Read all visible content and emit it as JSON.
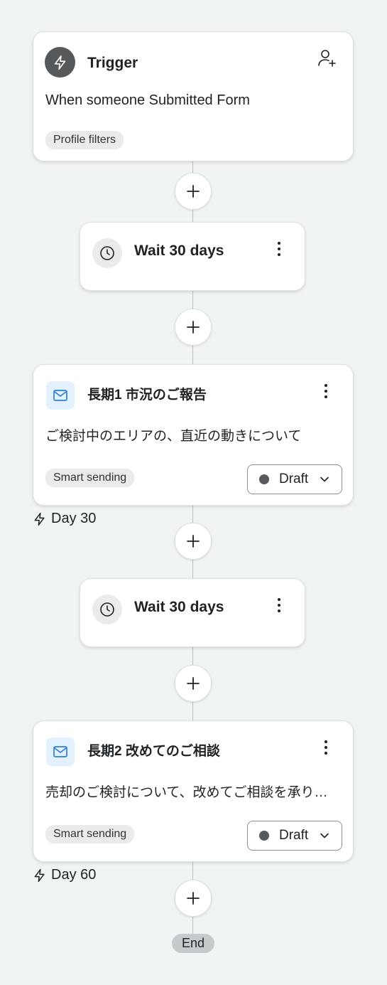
{
  "trigger": {
    "title": "Trigger",
    "description": "When someone Submitted Form",
    "filter_label": "Profile filters",
    "icon": "lightning-icon",
    "action_icon": "add-person-icon"
  },
  "wait_1": {
    "label": "Wait 30 days",
    "icon": "clock-icon"
  },
  "email_1": {
    "title": "長期1 市況のご報告",
    "preview": "ご検討中のエリアの、直近の動きについて",
    "smart_sending": "Smart sending",
    "status": "Draft",
    "day": "Day 30",
    "icon": "mail-icon"
  },
  "wait_2": {
    "label": "Wait 30 days",
    "icon": "clock-icon"
  },
  "email_2": {
    "title": "長期2 改めてのご相談",
    "preview": "売却のご検討について、改めてご相談を承り…",
    "smart_sending": "Smart sending",
    "status": "Draft",
    "day": "Day 60",
    "icon": "mail-icon"
  },
  "end_label": "End",
  "colors": {
    "background": "#f1f4f5",
    "card": "#ffffff",
    "trigger_icon_bg": "#56595c",
    "mail_icon_bg": "#e3f0fd",
    "mail_icon": "#2f7fd6",
    "draft_dot": "#55595d",
    "end_pill": "#c7cacd"
  }
}
